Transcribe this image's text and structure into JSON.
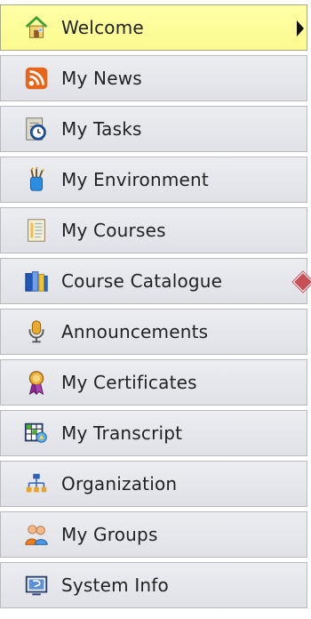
{
  "menu": {
    "items": [
      {
        "label": "Welcome",
        "icon": "home-icon",
        "active": true
      },
      {
        "label": "My News",
        "icon": "rss-icon"
      },
      {
        "label": "My Tasks",
        "icon": "clock-icon"
      },
      {
        "label": "My Environment",
        "icon": "paint-brush-icon"
      },
      {
        "label": "My Courses",
        "icon": "document-icon"
      },
      {
        "label": "Course Catalogue",
        "icon": "books-icon"
      },
      {
        "label": "Announcements",
        "icon": "microphone-icon"
      },
      {
        "label": "My Certificates",
        "icon": "award-ribbon-icon"
      },
      {
        "label": "My Transcript",
        "icon": "spreadsheet-icon"
      },
      {
        "label": "Organization",
        "icon": "org-chart-icon"
      },
      {
        "label": "My Groups",
        "icon": "users-icon"
      },
      {
        "label": "System Info",
        "icon": "system-info-icon"
      }
    ]
  },
  "colors": {
    "active_background": "#fbfb8f",
    "item_background": "#e3e4e9",
    "item_border": "#b9b9c0",
    "text": "#222222",
    "edge_marker": "#c74f57"
  }
}
